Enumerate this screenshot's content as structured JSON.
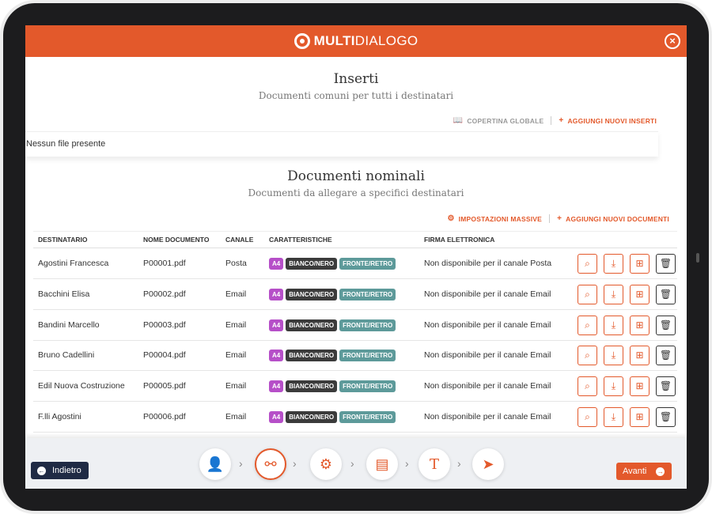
{
  "brand": {
    "logo_bold": "MULTI",
    "logo_light": "DIALOGO",
    "accent": "#e3592b",
    "dark": "#1f2a44"
  },
  "close_icon": "close-circle-icon",
  "inserti": {
    "title": "Inserti",
    "subtitle": "Documenti comuni per tutti i destinatari",
    "cover_label": "COPERTINA GLOBALE",
    "add_label": "AGGIUNGI NUOVI INSERTI",
    "empty_text": "Nessun file presente"
  },
  "nominali": {
    "title": "Documenti nominali",
    "subtitle": "Documenti da allegare a specifici destinatari",
    "bulk_label": "IMPOSTAZIONI MASSIVE",
    "add_label": "AGGIUNGI NUOVI DOCUMENTI"
  },
  "table": {
    "headers": [
      "DESTINATARIO",
      "NOME DOCUMENTO",
      "CANALE",
      "CARATTERISTICHE",
      "FIRMA ELETTRONICA"
    ],
    "badges": {
      "format": "A4",
      "color": "BIANCO/NERO",
      "sides": "FRONTE/RETRO"
    },
    "rows": [
      {
        "recipient": "Agostini Francesca",
        "document": "P00001.pdf",
        "channel": "Posta",
        "signature": "Non disponibile per il canale Posta"
      },
      {
        "recipient": "Bacchini Elisa",
        "document": "P00002.pdf",
        "channel": "Email",
        "signature": "Non disponibile per il canale Email"
      },
      {
        "recipient": "Bandini Marcello",
        "document": "P00003.pdf",
        "channel": "Email",
        "signature": "Non disponibile per il canale Email"
      },
      {
        "recipient": "Bruno Cadellini",
        "document": "P00004.pdf",
        "channel": "Email",
        "signature": "Non disponibile per il canale Email"
      },
      {
        "recipient": "Edil Nuova Costruzione",
        "document": "P00005.pdf",
        "channel": "Email",
        "signature": "Non disponibile per il canale Email"
      },
      {
        "recipient": "F.lli Agostini",
        "document": "P00006.pdf",
        "channel": "Email",
        "signature": "Non disponibile per il canale Email"
      }
    ]
  },
  "footer": {
    "back_label": "Indietro",
    "next_label": "Avanti",
    "steps": [
      {
        "icon": "contacts-icon",
        "active": false
      },
      {
        "icon": "channels-network-icon",
        "active": true
      },
      {
        "icon": "settings-gear-icon",
        "active": false
      },
      {
        "icon": "document-icon",
        "active": false
      },
      {
        "icon": "text-icon",
        "active": false
      },
      {
        "icon": "send-paper-plane-icon",
        "active": false
      }
    ]
  }
}
